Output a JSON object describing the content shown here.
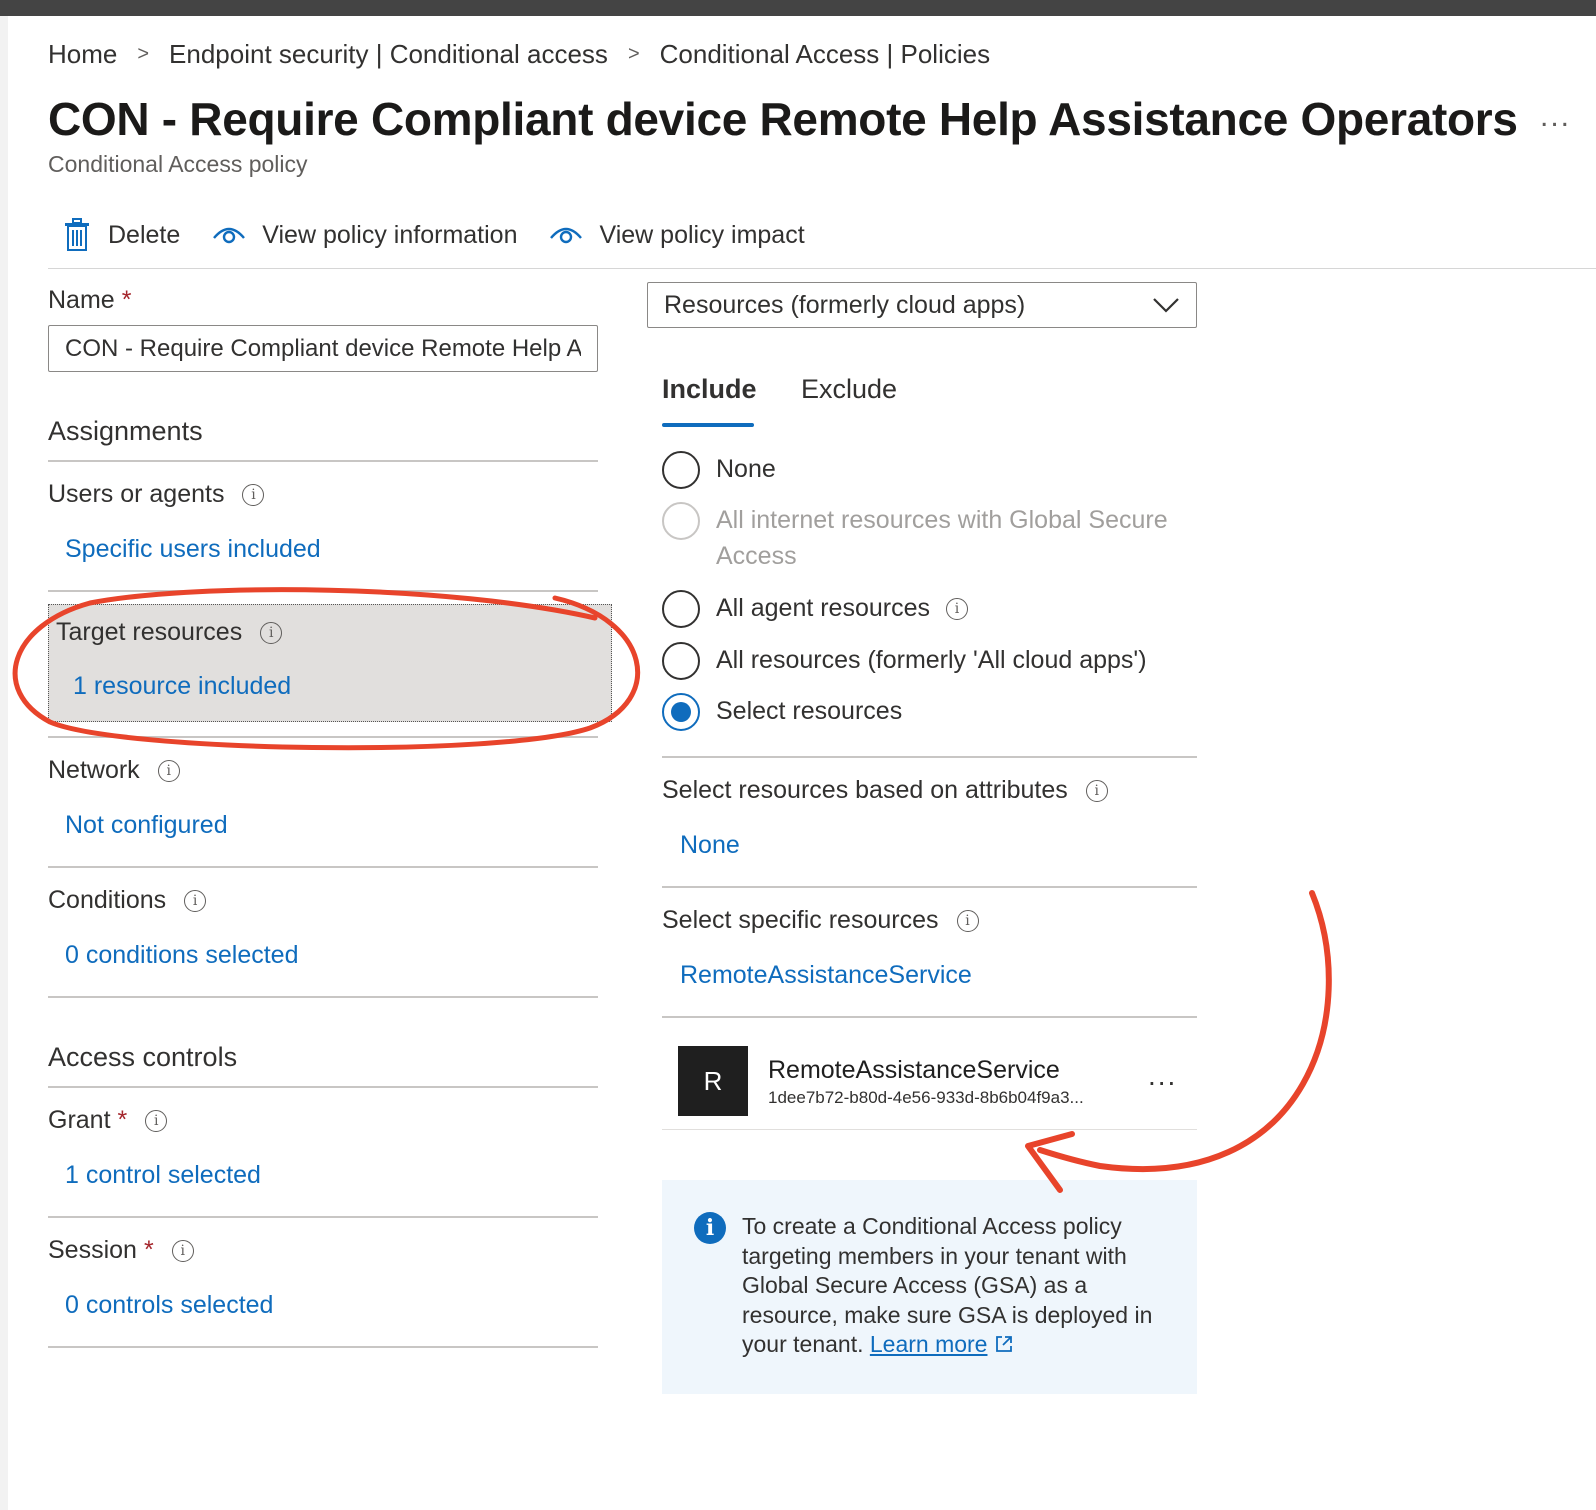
{
  "breadcrumb": {
    "items": [
      "Home",
      "Endpoint security | Conditional access",
      "Conditional Access | Policies"
    ],
    "separator": ">"
  },
  "page": {
    "title": "CON - Require Compliant device Remote Help Assistance Operators",
    "subtitle": "Conditional Access policy",
    "more": "..."
  },
  "toolbar": {
    "delete_label": "Delete",
    "view_info_label": "View policy information",
    "view_impact_label": "View policy impact"
  },
  "form": {
    "name_label": "Name",
    "required_mark": "*",
    "name_value": "CON - Require Compliant device Remote Help Assistance Operators",
    "assignments_heading": "Assignments",
    "users_label": "Users or agents",
    "users_value": "Specific users included",
    "target_label": "Target resources",
    "target_value": "1 resource included",
    "network_label": "Network",
    "network_value": "Not configured",
    "conditions_label": "Conditions",
    "conditions_value": "0 conditions selected",
    "access_controls_heading": "Access controls",
    "grant_label": "Grant",
    "grant_value": "1 control selected",
    "session_label": "Session",
    "session_value": "0 controls selected"
  },
  "resources": {
    "dropdown_value": "Resources (formerly cloud apps)",
    "tabs": [
      {
        "label": "Include",
        "active": true
      },
      {
        "label": "Exclude",
        "active": false
      }
    ],
    "options": [
      {
        "label": "None",
        "state": "unchecked"
      },
      {
        "label": "All internet resources with Global Secure",
        "label2": "Access",
        "state": "disabled"
      },
      {
        "label": "All agent resources",
        "state": "unchecked"
      },
      {
        "label": "All resources (formerly 'All cloud apps')",
        "state": "unchecked"
      },
      {
        "label": "Select resources",
        "state": "checked"
      }
    ],
    "attributes_label": "Select resources based on attributes",
    "attributes_value": "None",
    "specific_label": "Select specific resources",
    "specific_value": "RemoteAssistanceService",
    "selected_item": {
      "initial": "R",
      "name": "RemoteAssistanceService",
      "id": "1dee7b72-b80d-4e56-933d-8b6b04f9a3...",
      "more": "..."
    },
    "info_text": "To create a Conditional Access policy targeting members in your tenant with Global Secure Access (GSA) as a resource, make sure GSA is deployed in your tenant.",
    "info_link": "Learn more"
  },
  "colors": {
    "link": "#0f6cbd",
    "annotation": "#e8442b",
    "highlight_bg": "#e1dfdd",
    "info_bg": "#eff6fc"
  }
}
